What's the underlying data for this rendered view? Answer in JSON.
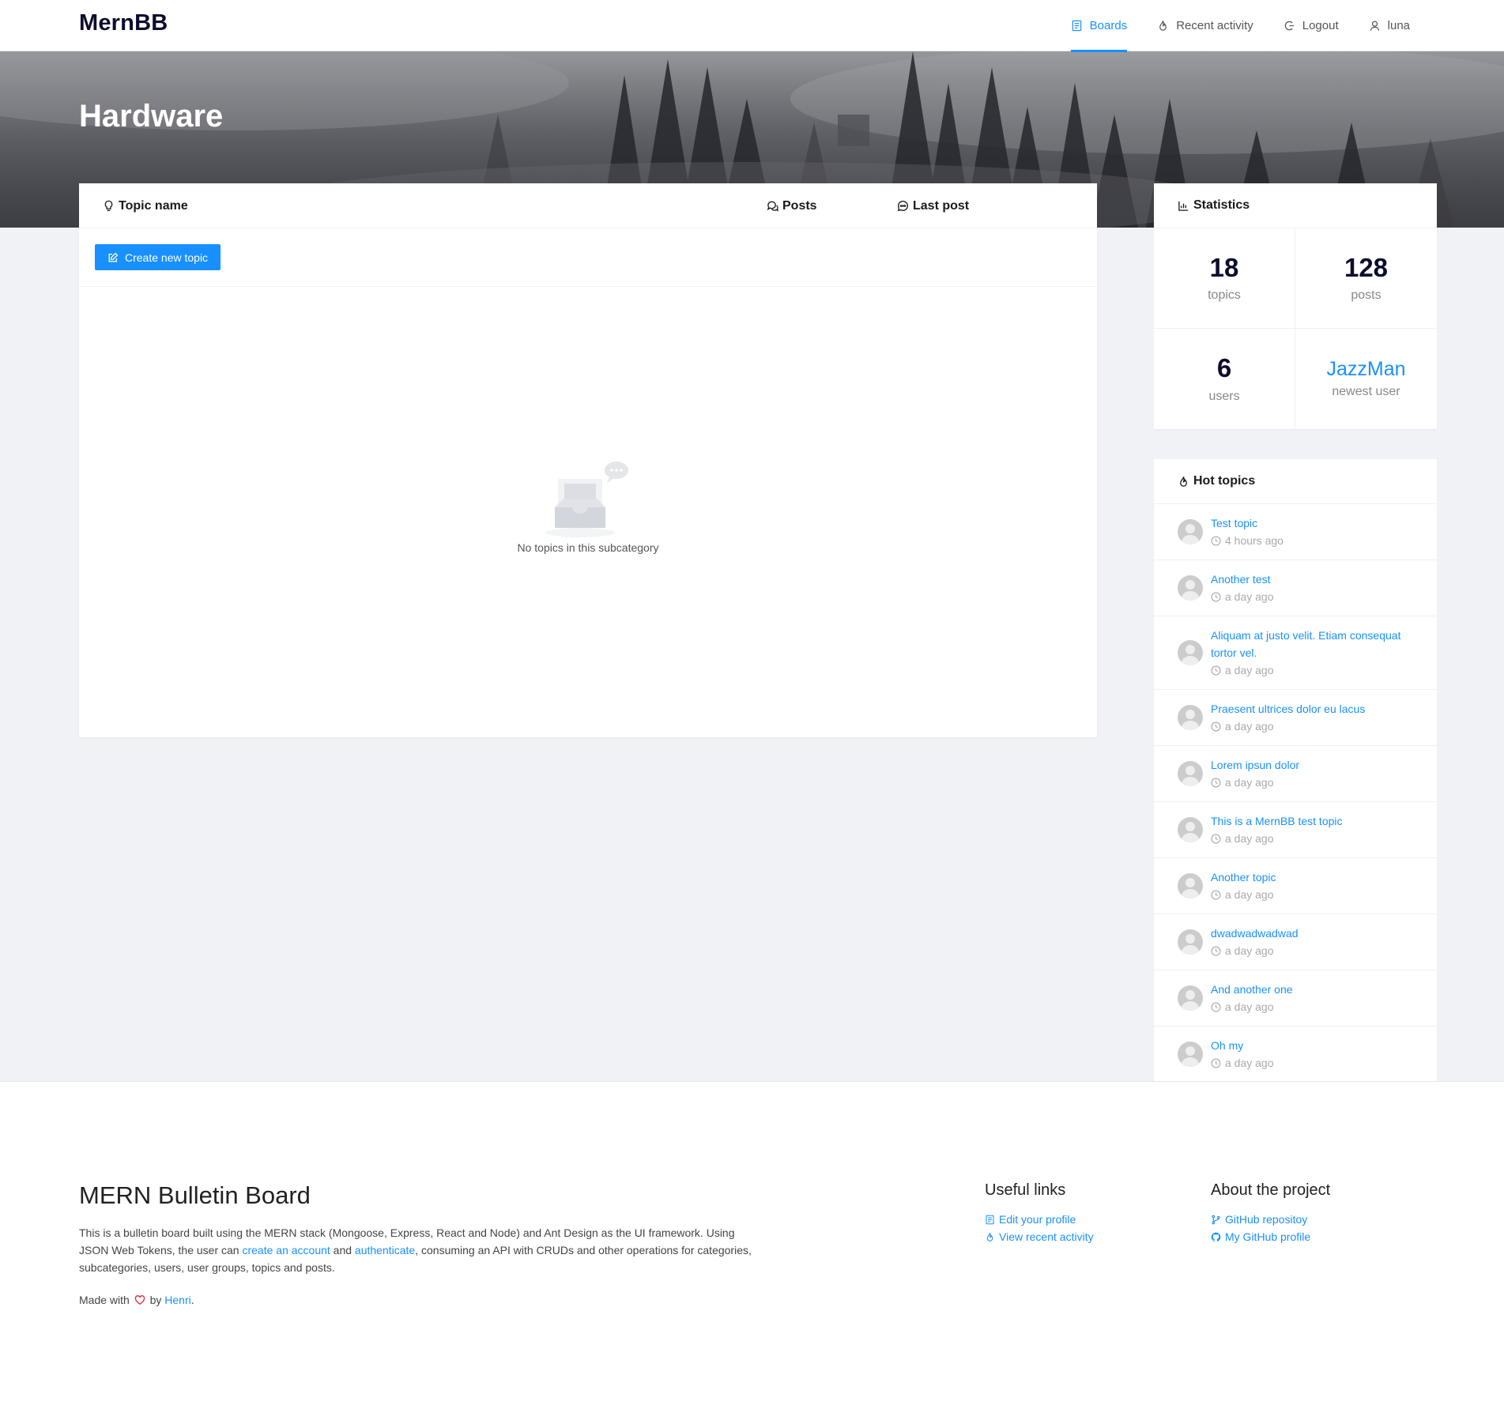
{
  "header": {
    "logo": "MernBB",
    "nav": [
      {
        "label": "Boards",
        "icon": "book-icon",
        "active": true
      },
      {
        "label": "Recent activity",
        "icon": "fire-icon"
      },
      {
        "label": "Logout",
        "icon": "logout-icon"
      },
      {
        "label": "luna",
        "icon": "user-icon"
      }
    ]
  },
  "hero": {
    "title": "Hardware"
  },
  "topics": {
    "columns": {
      "topic_name": "Topic name",
      "posts": "Posts",
      "last_post": "Last post"
    },
    "create_button": "Create new topic",
    "empty_text": "No topics in this subcategory"
  },
  "statistics": {
    "title": "Statistics",
    "topics_count": "18",
    "topics_label": "topics",
    "posts_count": "128",
    "posts_label": "posts",
    "users_count": "6",
    "users_label": "users",
    "newest_user": "JazzMan",
    "newest_user_label": "newest user"
  },
  "hot_topics": {
    "title": "Hot topics",
    "items": [
      {
        "title": "Test topic",
        "time": "4 hours ago"
      },
      {
        "title": "Another test",
        "time": "a day ago"
      },
      {
        "title": "Aliquam at justo velit. Etiam consequat tortor vel.",
        "time": "a day ago"
      },
      {
        "title": "Praesent ultrices dolor eu lacus",
        "time": "a day ago"
      },
      {
        "title": "Lorem ipsun dolor",
        "time": "a day ago"
      },
      {
        "title": "This is a MernBB test topic",
        "time": "a day ago"
      },
      {
        "title": "Another topic",
        "time": "a day ago"
      },
      {
        "title": "dwadwadwadwad",
        "time": "a day ago"
      },
      {
        "title": "And another one",
        "time": "a day ago"
      },
      {
        "title": "Oh my",
        "time": "a day ago"
      }
    ]
  },
  "footer": {
    "title": "MERN Bulletin Board",
    "desc_part1": "This is a bulletin board built using the MERN stack (Mongoose, Express, React and Node) and Ant Design as the UI framework. Using JSON Web Tokens, the user can ",
    "desc_link1": "create an account",
    "desc_part2": " and ",
    "desc_link2": "authenticate",
    "desc_part3": ", consuming an API with CRUDs and other operations for categories, subcategories, users, user groups, topics and posts.",
    "made_prefix": "Made with",
    "made_by": "by",
    "author": "Henri",
    "made_suffix": ".",
    "useful_links": {
      "title": "Useful links",
      "items": [
        {
          "label": "Edit your profile",
          "icon": "book-icon"
        },
        {
          "label": "View recent activity",
          "icon": "fire-icon"
        }
      ]
    },
    "about": {
      "title": "About the project",
      "items": [
        {
          "label": "GitHub repositoy",
          "icon": "branch-icon"
        },
        {
          "label": "My GitHub profile",
          "icon": "github-icon"
        }
      ]
    }
  },
  "colors": {
    "accent": "#1890ff",
    "heading": "#0c0c2e",
    "background": "#f0f2f5"
  }
}
